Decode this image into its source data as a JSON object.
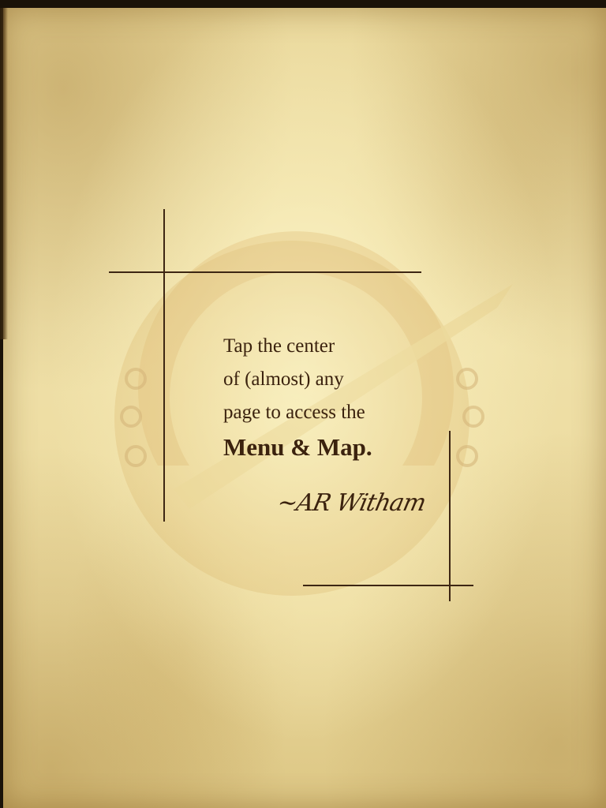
{
  "instruction": {
    "line1": "Tap the center",
    "line2": "of (almost) any",
    "line3": "page to access the",
    "emphasis": "Menu & Map."
  },
  "signature": "~AR Witham",
  "colors": {
    "ink": "#3b220e",
    "frame_lines": "#3d2613",
    "parchment": "#efe0a8"
  },
  "decor": {
    "background": "aged-parchment",
    "emblem": "faded-horseshoe-with-arrow-icon"
  }
}
